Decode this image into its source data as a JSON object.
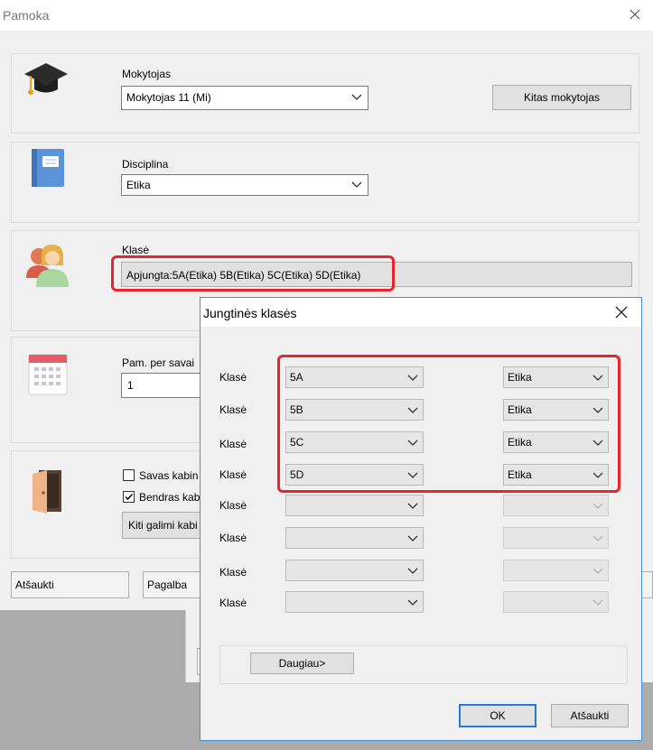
{
  "main": {
    "title": "Pamoka",
    "teacher": {
      "label": "Mokytojas",
      "value": "Mokytojas 11 (Mi)",
      "other_button": "Kitas mokytojas"
    },
    "discipline": {
      "label": "Disciplina",
      "value": "Etika"
    },
    "class": {
      "label": "Klasė",
      "value": "Apjungta:5A(Etika) 5B(Etika) 5C(Etika) 5D(Etika)"
    },
    "weekly": {
      "label": "Pam. per savai",
      "value": "1"
    },
    "room": {
      "own_label": "Savas kabin",
      "shared_label": "Bendras kab",
      "other_button": "Kiti galimi kabi"
    },
    "buttons": {
      "cancel": "Atšaukti",
      "help": "Pagalba"
    }
  },
  "dialog": {
    "title": "Jungtinės klasės",
    "row_label": "Klasė",
    "rows": [
      {
        "cls": "5A",
        "subj": "Etika"
      },
      {
        "cls": "5B",
        "subj": "Etika"
      },
      {
        "cls": "5C",
        "subj": "Etika"
      },
      {
        "cls": "5D",
        "subj": "Etika"
      },
      {
        "cls": "",
        "subj": ""
      },
      {
        "cls": "",
        "subj": ""
      },
      {
        "cls": "",
        "subj": ""
      },
      {
        "cls": "",
        "subj": ""
      }
    ],
    "more_button": "Daugiau>",
    "ok_button": "OK",
    "cancel_button": "Atšaukti"
  },
  "colors": {
    "highlight": "#e8242c",
    "dialog_border": "#4a90d9"
  }
}
